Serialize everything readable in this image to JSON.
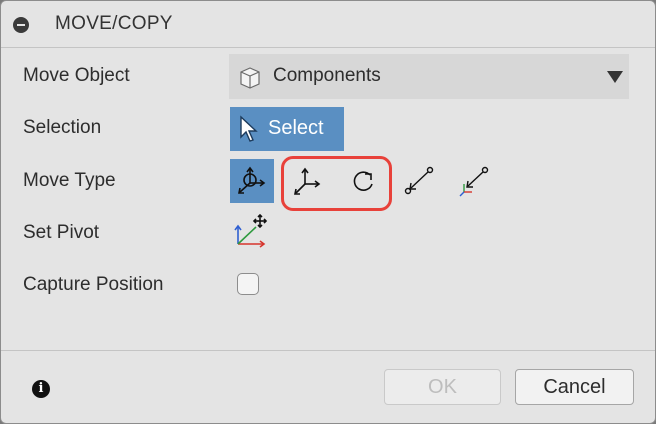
{
  "dialog": {
    "title": "MOVE/COPY",
    "rows": {
      "move_object": {
        "label": "Move Object",
        "value": "Components"
      },
      "selection": {
        "label": "Selection",
        "button_label": "Select"
      },
      "move_type": {
        "label": "Move Type",
        "options": [
          "free-move-icon",
          "translate-icon",
          "rotate-icon",
          "point-to-point-icon",
          "point-to-position-icon"
        ],
        "selected": "free-move-icon"
      },
      "set_pivot": {
        "label": "Set Pivot"
      },
      "capture_position": {
        "label": "Capture Position",
        "checked": false
      }
    },
    "footer": {
      "ok_label": "OK",
      "cancel_label": "Cancel",
      "info_glyph": "i"
    }
  },
  "colors": {
    "accent": "#5a8fc2",
    "highlight": "#e8413a",
    "panel": "#e4e4e4"
  }
}
